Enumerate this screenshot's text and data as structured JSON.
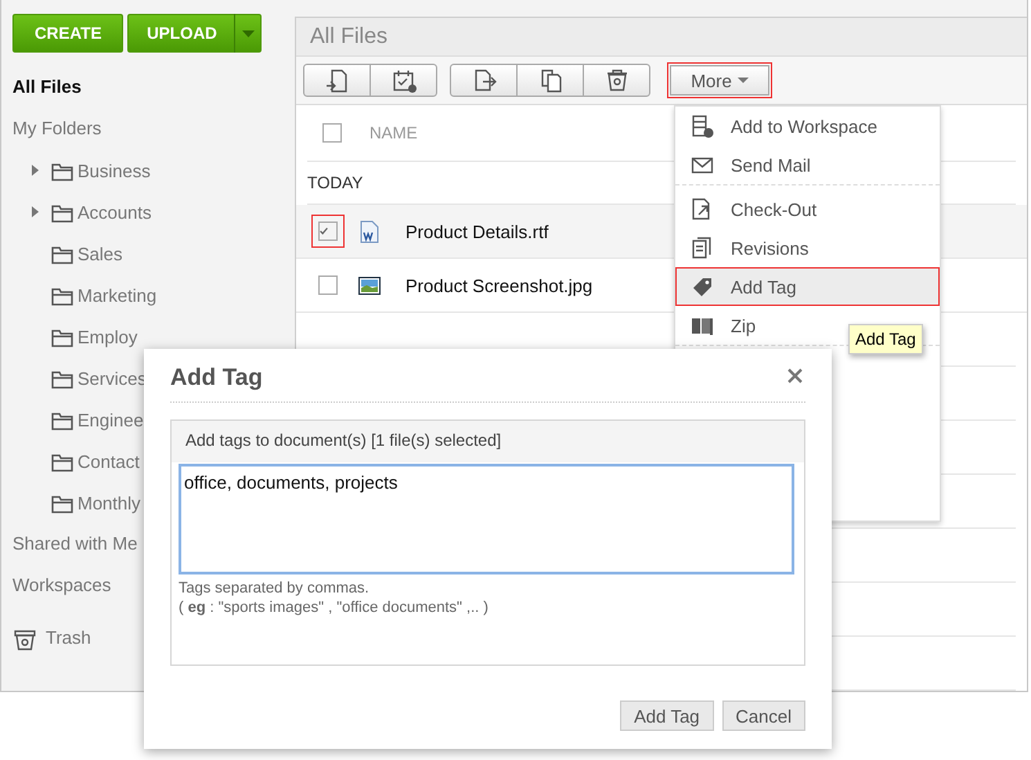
{
  "actions": [
    {
      "label": "CREATE",
      "kind": "plain"
    },
    {
      "label": "UPLOAD",
      "kind": "split"
    }
  ],
  "sidebar": {
    "items": [
      {
        "label": "All Files",
        "selected": true,
        "kind": "link"
      },
      {
        "label": "My Folders",
        "selected": false,
        "kind": "link",
        "children": [
          {
            "label": "Business",
            "expandable": true
          },
          {
            "label": "Accounts",
            "expandable": true
          },
          {
            "label": "Sales",
            "expandable": false
          },
          {
            "label": "Marketing",
            "expandable": false
          },
          {
            "label": "Employ",
            "expandable": false
          },
          {
            "label": "Services",
            "expandable": false
          },
          {
            "label": "Enginee",
            "expandable": false
          },
          {
            "label": "Contact",
            "expandable": false
          },
          {
            "label": "Monthly",
            "expandable": false
          }
        ]
      },
      {
        "label": "Shared with Me",
        "selected": false,
        "kind": "link"
      },
      {
        "label": "Workspaces",
        "selected": false,
        "kind": "link"
      },
      {
        "label": "Trash",
        "selected": false,
        "kind": "trash"
      }
    ]
  },
  "main": {
    "title": "All Files",
    "toolbar": {
      "groups": [
        [
          {
            "kind": "move"
          },
          {
            "kind": "schedule"
          }
        ],
        [
          {
            "kind": "share"
          },
          {
            "kind": "copy"
          },
          {
            "kind": "delete"
          }
        ]
      ],
      "more": "More"
    },
    "table": {
      "columns": [
        "NAME"
      ],
      "all_checked": false,
      "sections": [
        {
          "label": "TODAY",
          "rows": [
            {
              "name": "Product Details.rtf",
              "kind": "doc",
              "selected": true
            },
            {
              "name": "Product Screenshot.jpg",
              "kind": "image",
              "selected": false
            }
          ]
        }
      ]
    }
  },
  "menu": {
    "groups": [
      [
        {
          "label": "Add to Workspace",
          "kind": "workspace",
          "selected": false
        },
        {
          "label": "Send Mail",
          "kind": "mail",
          "selected": false
        }
      ],
      [
        {
          "label": "Check-Out",
          "kind": "checkout",
          "selected": false
        },
        {
          "label": "Revisions",
          "kind": "revisions",
          "selected": false
        },
        {
          "label": "Add Tag",
          "kind": "tag",
          "selected": true
        },
        {
          "label": "Zip",
          "kind": "zip",
          "selected": false
        }
      ]
    ]
  },
  "tooltip": {
    "text": "Add Tag"
  },
  "dialog": {
    "title": "Add Tag",
    "prompt": "Add tags to document(s) [1 file(s) selected]",
    "value": "office, documents, projects",
    "hints": [
      "Tags separated by commas.",
      "( **eg** : \"sports images\" , \"office documents\" ,.. )"
    ],
    "buttons": [
      "Add Tag",
      "Cancel"
    ]
  }
}
